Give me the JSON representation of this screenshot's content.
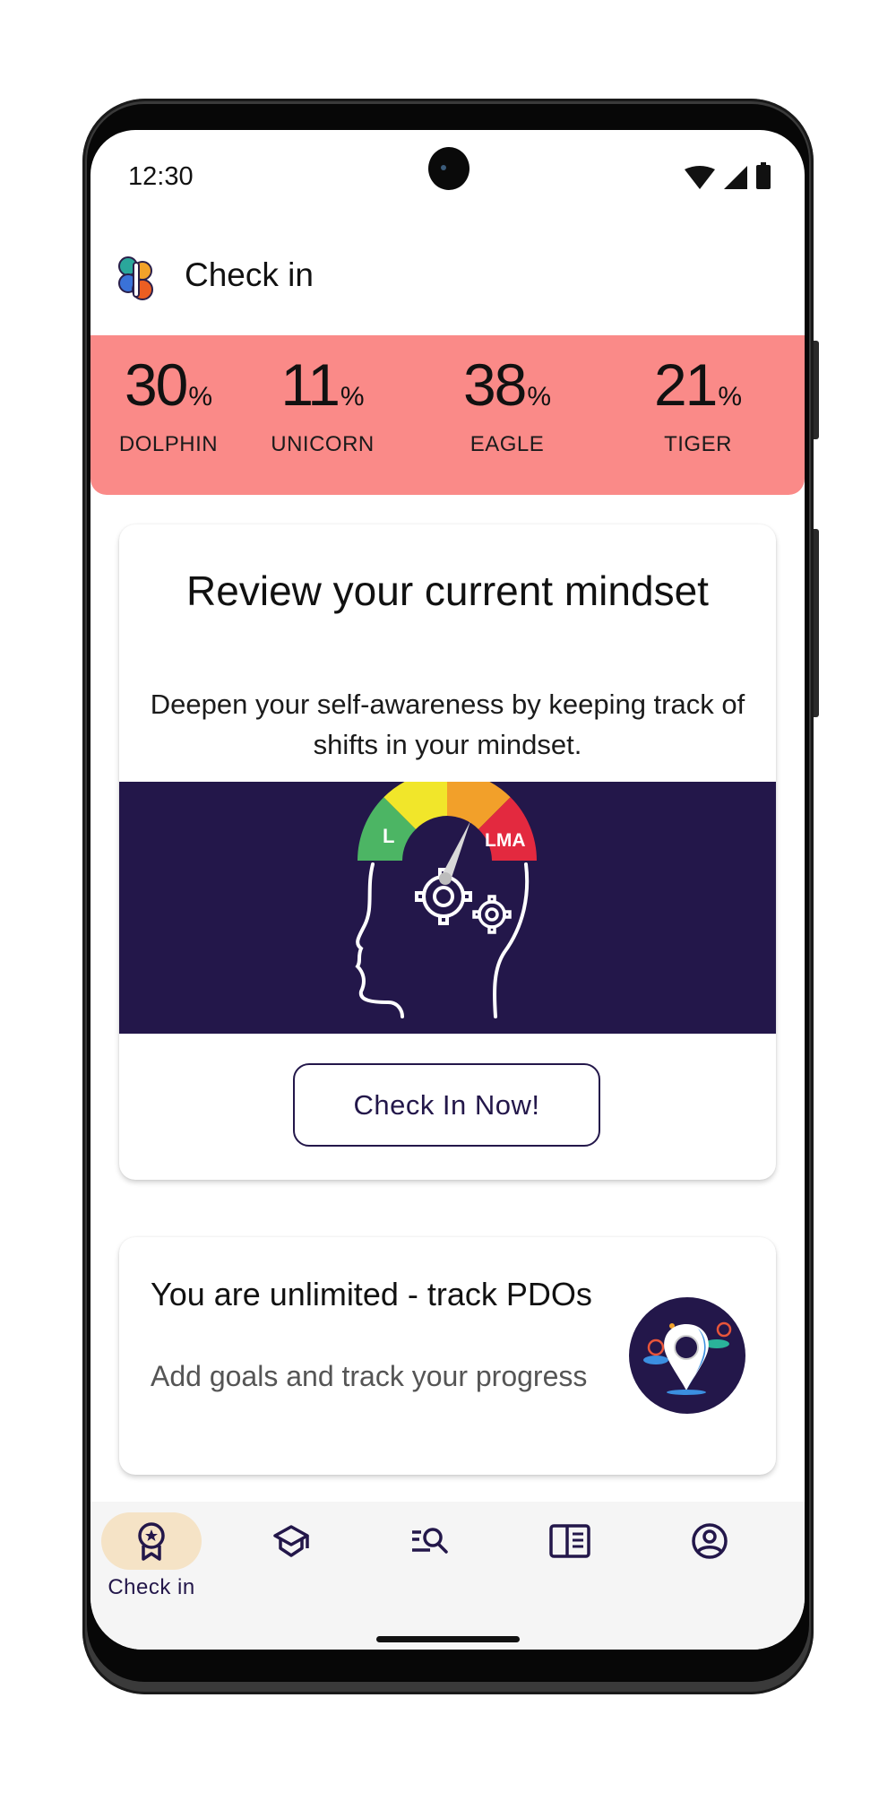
{
  "status_bar": {
    "time": "12:30",
    "icons": [
      "wifi-icon",
      "cellular-signal-icon",
      "battery-icon"
    ]
  },
  "app_bar": {
    "logo": "app-logo",
    "title": "Check in"
  },
  "stats": [
    {
      "value": "30",
      "unit": "%",
      "label": "DOLPHIN"
    },
    {
      "value": "11",
      "unit": "%",
      "label": "UNICORN"
    },
    {
      "value": "38",
      "unit": "%",
      "label": "EAGLE"
    },
    {
      "value": "21",
      "unit": "%",
      "label": "TIGER"
    }
  ],
  "mindset_card": {
    "title": "Review your current mindset",
    "subtitle": "Deepen your self-awareness by keeping track of shifts in your mindset.",
    "illustration": {
      "description": "head-with-gauge-illustration",
      "gauge_left_label": "L",
      "gauge_right_label": "LMA"
    },
    "button_label": "Check In Now!"
  },
  "pdo_card": {
    "title": "You are unlimited - track PDOs",
    "subtitle": "Add goals and track your progress",
    "icon": "location-pin-illustration"
  },
  "bottom_nav": {
    "items": [
      {
        "icon": "award-ribbon-icon",
        "label": "Check in",
        "active": true
      },
      {
        "icon": "graduation-cap-icon",
        "label": "",
        "active": false
      },
      {
        "icon": "list-search-icon",
        "label": "",
        "active": false
      },
      {
        "icon": "book-open-icon",
        "label": "",
        "active": false
      },
      {
        "icon": "account-circle-icon",
        "label": "",
        "active": false
      }
    ]
  },
  "colors": {
    "stats_band": "#fa8a88",
    "brand_dark": "#23174a",
    "nav_active_pill": "#f5e3c6",
    "nav_background": "#f5f5f5"
  }
}
